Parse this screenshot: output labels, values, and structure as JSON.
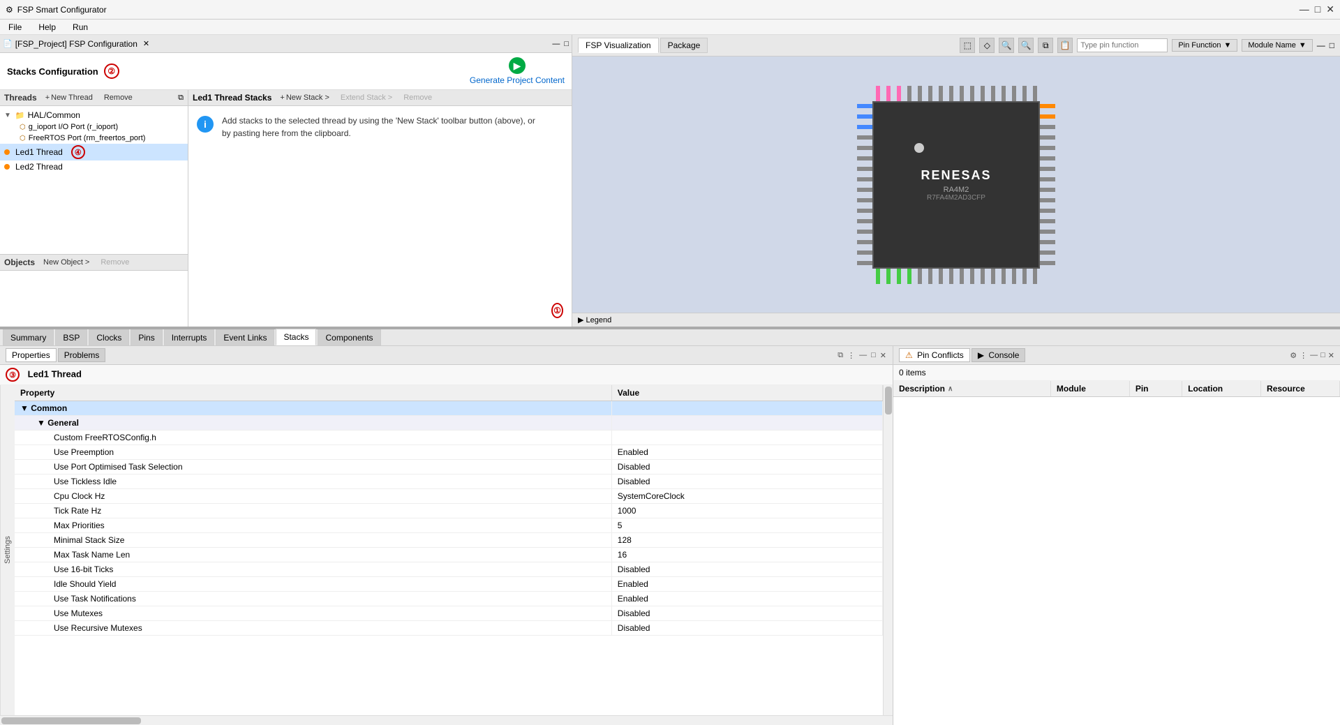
{
  "app": {
    "title": "FSP Smart Configurator",
    "icon": "⚙"
  },
  "title_bar": {
    "title": "FSP Smart Configurator",
    "minimize": "—",
    "maximize": "□",
    "close": "✕"
  },
  "menu": {
    "items": [
      "File",
      "Help",
      "Run"
    ]
  },
  "tab_bar": {
    "tab_label": "[FSP_Project] FSP Configuration",
    "close": "✕"
  },
  "stacks_config": {
    "title": "Stacks Configuration",
    "generate_btn": "Generate Project Content",
    "annotation2": "②"
  },
  "threads": {
    "label": "Threads",
    "new_thread_btn": "New Thread",
    "remove_btn": "Remove",
    "tree": [
      {
        "label": "HAL/Common",
        "level": 0,
        "type": "folder",
        "expanded": true
      },
      {
        "label": "g_ioport I/O Port (r_ioport)",
        "level": 1,
        "type": "port"
      },
      {
        "label": "FreeRTOS Port (rm_freertos_port)",
        "level": 1,
        "type": "port"
      },
      {
        "label": "Led1 Thread",
        "level": 0,
        "type": "thread",
        "selected": true
      },
      {
        "label": "Led2 Thread",
        "level": 0,
        "type": "thread"
      }
    ],
    "annotation4": "④"
  },
  "objects": {
    "label": "Objects",
    "new_object_btn": "New Object >",
    "remove_btn": "Remove"
  },
  "led1_thread_stacks": {
    "title": "Led1 Thread Stacks",
    "new_stack_btn": "New Stack >",
    "extend_stack_btn": "Extend Stack >",
    "remove_btn": "Remove",
    "info_text": "Add stacks to the selected thread by using the 'New Stack' toolbar button (above), or by pasting here from the clipboard.",
    "annotation1": "①"
  },
  "visualization": {
    "panel_title": "FSP Visualization",
    "tab_package": "Package",
    "tab_active": "FSP Visualization",
    "pin_function_placeholder": "Type pin function",
    "dropdown1": "Pin Function",
    "dropdown2": "Module Name",
    "chip": {
      "logo": "RENESAS",
      "model": "RA4M2",
      "variant": "R7FA4M2AD3CFP"
    },
    "legend": "▶ Legend"
  },
  "bottom_tabs": {
    "tabs": [
      "Summary",
      "BSP",
      "Clocks",
      "Pins",
      "Interrupts",
      "Event Links",
      "Stacks",
      "Components"
    ],
    "active": "Stacks"
  },
  "properties": {
    "panel_title": "Properties",
    "tabs": [
      "Properties",
      "Problems"
    ],
    "active_tab": "Properties",
    "section_title": "Led1 Thread",
    "settings_label": "Settings",
    "columns": [
      "Property",
      "Value"
    ],
    "annotation3": "③",
    "rows": [
      {
        "label": "Common",
        "level": 0,
        "type": "section",
        "value": ""
      },
      {
        "label": "General",
        "level": 1,
        "type": "subsection",
        "value": ""
      },
      {
        "label": "Custom FreeRTOSConfig.h",
        "level": 2,
        "type": "prop",
        "value": ""
      },
      {
        "label": "Use Preemption",
        "level": 2,
        "type": "prop",
        "value": "Enabled"
      },
      {
        "label": "Use Port Optimised Task Selection",
        "level": 2,
        "type": "prop",
        "value": "Disabled"
      },
      {
        "label": "Use Tickless Idle",
        "level": 2,
        "type": "prop",
        "value": "Disabled"
      },
      {
        "label": "Cpu Clock Hz",
        "level": 2,
        "type": "prop",
        "value": "SystemCoreClock"
      },
      {
        "label": "Tick Rate Hz",
        "level": 2,
        "type": "prop",
        "value": "1000"
      },
      {
        "label": "Max Priorities",
        "level": 2,
        "type": "prop",
        "value": "5"
      },
      {
        "label": "Minimal Stack Size",
        "level": 2,
        "type": "prop",
        "value": "128"
      },
      {
        "label": "Max Task Name Len",
        "level": 2,
        "type": "prop",
        "value": "16"
      },
      {
        "label": "Use 16-bit Ticks",
        "level": 2,
        "type": "prop",
        "value": "Disabled"
      },
      {
        "label": "Idle Should Yield",
        "level": 2,
        "type": "prop",
        "value": "Enabled"
      },
      {
        "label": "Use Task Notifications",
        "level": 2,
        "type": "prop",
        "value": "Enabled"
      },
      {
        "label": "Use Mutexes",
        "level": 2,
        "type": "prop",
        "value": "Disabled"
      },
      {
        "label": "Use Recursive Mutexes",
        "level": 2,
        "type": "prop",
        "value": "Disabled"
      }
    ]
  },
  "pin_conflicts": {
    "tab_label": "Pin Conflicts",
    "console_tab": "Console",
    "count_text": "0 items",
    "columns": [
      "Description",
      "Module",
      "Pin",
      "Location",
      "Resource"
    ],
    "filter_icon": "filter",
    "minimize": "—",
    "maximize": "□",
    "close": "✕"
  }
}
